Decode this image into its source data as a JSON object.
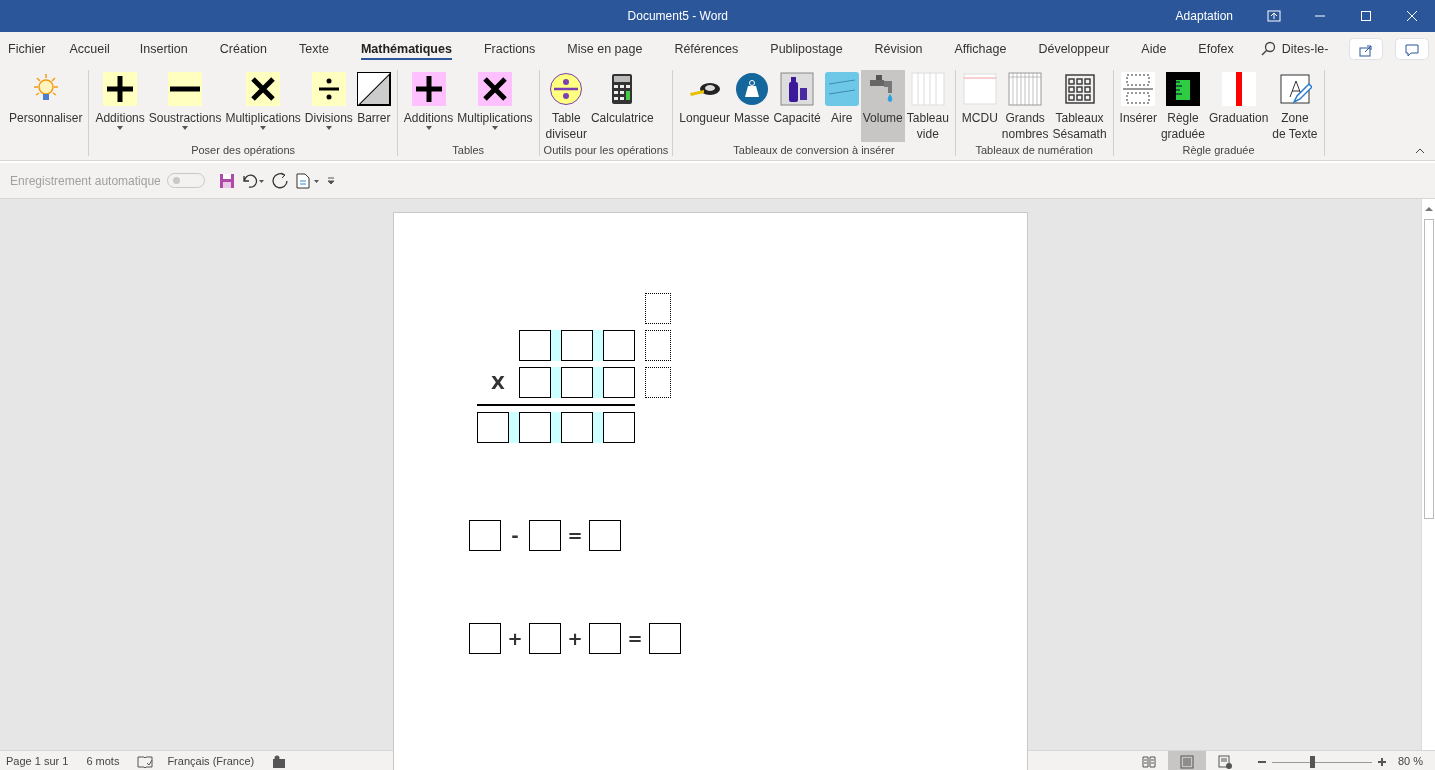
{
  "window": {
    "title": "Document5  -  Word",
    "account": "Adaptation"
  },
  "tabs": [
    {
      "label": "Fichier",
      "selected": false
    },
    {
      "label": "Accueil",
      "selected": false
    },
    {
      "label": "Insertion",
      "selected": false
    },
    {
      "label": "Création",
      "selected": false
    },
    {
      "label": "Texte",
      "selected": false
    },
    {
      "label": "Mathématiques",
      "selected": true
    },
    {
      "label": "Fractions",
      "selected": false
    },
    {
      "label": "Mise en page",
      "selected": false
    },
    {
      "label": "Références",
      "selected": false
    },
    {
      "label": "Publipostage",
      "selected": false
    },
    {
      "label": "Révision",
      "selected": false
    },
    {
      "label": "Affichage",
      "selected": false
    },
    {
      "label": "Développeur",
      "selected": false
    },
    {
      "label": "Aide",
      "selected": false
    },
    {
      "label": "Efofex",
      "selected": false
    }
  ],
  "tell_me": "Dites-le-",
  "ribbon_groups": [
    {
      "buttons": [
        {
          "label": "Personnaliser",
          "kind": "bulb",
          "dropdown": false,
          "selected": false
        }
      ]
    },
    {
      "label": "Poser des opérations",
      "buttons": [
        {
          "label": "Additions",
          "kind": "plus",
          "dropdown": true,
          "selected": false
        },
        {
          "label": "Soustractions",
          "kind": "minus",
          "dropdown": true,
          "selected": false
        },
        {
          "label": "Multiplications",
          "kind": "times",
          "dropdown": true,
          "selected": false
        },
        {
          "label": "Divisions",
          "kind": "divide",
          "dropdown": true,
          "selected": false
        },
        {
          "label": "Barrer",
          "kind": "strike",
          "dropdown": false,
          "selected": false
        }
      ]
    },
    {
      "label": "Tables",
      "buttons": [
        {
          "label": "Additions",
          "kind": "plus-pink",
          "dropdown": true,
          "selected": false
        },
        {
          "label": "Multiplications",
          "kind": "times-pink",
          "dropdown": true,
          "selected": false
        }
      ]
    },
    {
      "label": "Outils pour les opérations",
      "buttons": [
        {
          "label": "Table\ndiviseur",
          "kind": "divtable",
          "dropdown": false,
          "selected": false
        },
        {
          "label": "Calculatrice",
          "kind": "calculator",
          "dropdown": false,
          "selected": false
        }
      ]
    },
    {
      "label": "Tableaux de conversion à insérer",
      "buttons": [
        {
          "label": "Longueur",
          "kind": "tape",
          "dropdown": false,
          "selected": false
        },
        {
          "label": "Masse",
          "kind": "weight",
          "dropdown": false,
          "selected": false
        },
        {
          "label": "Capacité",
          "kind": "bottles",
          "dropdown": false,
          "selected": false
        },
        {
          "label": "Aire",
          "kind": "area",
          "dropdown": false,
          "selected": false
        },
        {
          "label": "Volume",
          "kind": "tap",
          "dropdown": false,
          "selected": true
        },
        {
          "label": "Tableau\nvide",
          "kind": "blanktable",
          "dropdown": false,
          "selected": false
        }
      ]
    },
    {
      "label": "Tableaux de numération",
      "buttons": [
        {
          "label": "MCDU",
          "kind": "mcdu",
          "dropdown": false,
          "selected": false
        },
        {
          "label": "Grands\nnombres",
          "kind": "bigtable",
          "dropdown": false,
          "selected": false
        },
        {
          "label": "Tableaux\nSésamath",
          "kind": "grid",
          "dropdown": false,
          "selected": false
        }
      ]
    },
    {
      "label": "Règle graduée",
      "buttons": [
        {
          "label": "Insérer",
          "kind": "insert",
          "dropdown": false,
          "selected": false
        },
        {
          "label": "Règle\ngraduée",
          "kind": "ruler",
          "dropdown": false,
          "selected": false
        },
        {
          "label": "Graduation",
          "kind": "graduation",
          "dropdown": false,
          "selected": false
        },
        {
          "label": "Zone\nde Texte",
          "kind": "textbox",
          "dropdown": false,
          "selected": false
        }
      ]
    }
  ],
  "quick_access": {
    "autosave_label": "Enregistrement automatique",
    "autosave_on": false
  },
  "document": {
    "operations": [
      {
        "kind": "column",
        "operator": "X"
      },
      {
        "kind": "equation",
        "operators": [
          "-",
          "="
        ]
      },
      {
        "kind": "equation",
        "operators": [
          "+",
          "+",
          "="
        ]
      }
    ]
  },
  "status_bar": {
    "page": "Page 1 sur 1",
    "words": "6 mots",
    "language": "Français (France)",
    "views": [
      {
        "kind": "read",
        "selected": false
      },
      {
        "kind": "print",
        "selected": true
      },
      {
        "kind": "web",
        "selected": false
      }
    ],
    "zoom": {
      "level": 0.4,
      "reading": "80 %"
    }
  }
}
